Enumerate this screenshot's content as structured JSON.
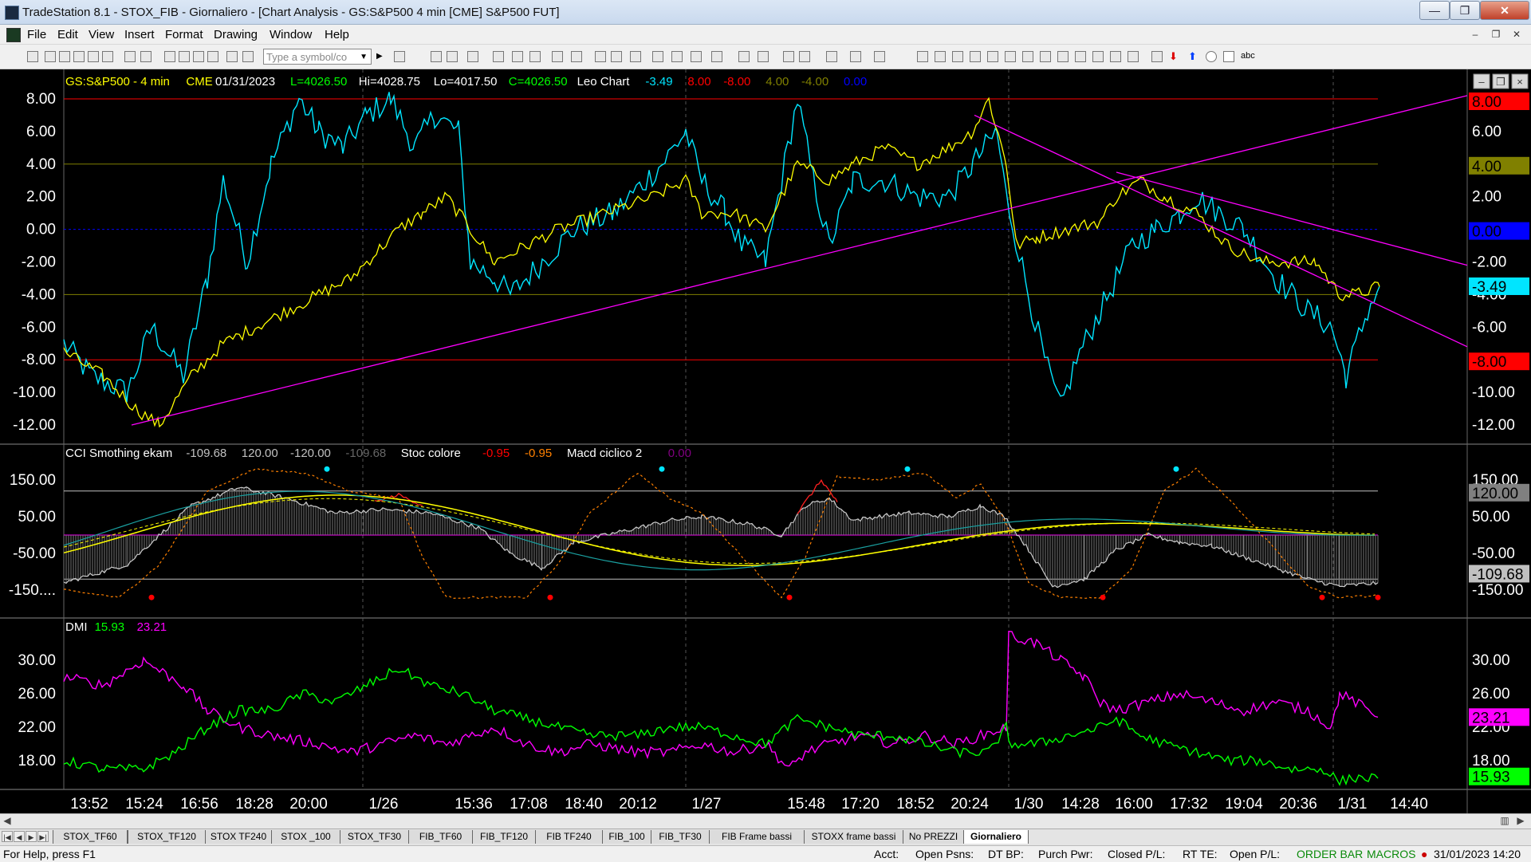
{
  "window": {
    "title": "TradeStation 8.1 - STOX_FIB - Giornaliero - [Chart Analysis - GS:S&P500  4 min  [CME] S&P500 FUT]",
    "buttons": {
      "minimize": "—",
      "maximize": "❐",
      "close": "✕"
    }
  },
  "menu": {
    "items": [
      "File",
      "Edit",
      "View",
      "Insert",
      "Format",
      "Drawing",
      "Window",
      "Help"
    ],
    "mdi": {
      "minimize": "–",
      "restore": "❐",
      "close": "✕"
    }
  },
  "toolbar": {
    "symbol_placeholder": "Type a symbol/co",
    "abc_label": "abc"
  },
  "chart": {
    "price_header": [
      {
        "text": "GS:S&P500 - 4 min",
        "color": "#ffff00"
      },
      {
        "text": "CME",
        "color": "#ffff00"
      },
      {
        "text": "01/31/2023",
        "color": "#ffffff"
      },
      {
        "text": "L=4026.50",
        "color": "#00ff00"
      },
      {
        "text": "Hi=4028.75",
        "color": "#ffffff"
      },
      {
        "text": "Lo=4017.50",
        "color": "#ffffff"
      },
      {
        "text": "C=4026.50",
        "color": "#00ff00"
      },
      {
        "text": "Leo Chart",
        "color": "#ffffff"
      },
      {
        "text": "-3.49",
        "color": "#00e5ff"
      },
      {
        "text": "8.00",
        "color": "#ff0000"
      },
      {
        "text": "-8.00",
        "color": "#ff0000"
      },
      {
        "text": "4.00",
        "color": "#808000"
      },
      {
        "text": "-4.00",
        "color": "#808000"
      },
      {
        "text": "0.00",
        "color": "#0000ff"
      }
    ],
    "cci_header": [
      {
        "text": "CCI Smothing ekam",
        "color": "#ffffff"
      },
      {
        "text": "-109.68",
        "color": "#c0c0c0"
      },
      {
        "text": "120.00",
        "color": "#c0c0c0"
      },
      {
        "text": "-120.00",
        "color": "#c0c0c0"
      },
      {
        "text": "-109.68",
        "color": "#666666"
      },
      {
        "text": "Stoc colore",
        "color": "#ffffff"
      },
      {
        "text": "-0.95",
        "color": "#ff0000"
      },
      {
        "text": "-0.95",
        "color": "#ff8000"
      },
      {
        "text": "Macd ciclico 2",
        "color": "#ffffff"
      },
      {
        "text": "0.00",
        "color": "#800080"
      }
    ],
    "dmi_header": [
      {
        "text": "DMI",
        "color": "#ffffff"
      },
      {
        "text": "15.93",
        "color": "#00ff00"
      },
      {
        "text": "23.21",
        "color": "#ff00ff"
      }
    ],
    "pane1_ticks": [
      "8.00",
      "6.00",
      "4.00",
      "2.00",
      "0.00",
      "-2.00",
      "-4.00",
      "-6.00",
      "-8.00",
      "-10.00",
      "-12.00"
    ],
    "pane1_right_ticks": [
      "6.00",
      "2.00",
      "-2.00",
      "-4.00",
      "-6.00",
      "-10.00",
      "-12.00"
    ],
    "pane2_ticks": [
      "150.00",
      "50.00",
      "-50.00",
      "-150...."
    ],
    "pane2_right_ticks": [
      "150.00",
      "50.00",
      "-50.00",
      "-150.00"
    ],
    "pane3_ticks": [
      "30.00",
      "26.00",
      "22.00",
      "18.00"
    ],
    "right_badges": [
      {
        "text": "8.00",
        "bg": "#ff0000",
        "fg": "#000000"
      },
      {
        "text": "4.00",
        "bg": "#808000",
        "fg": "#000000"
      },
      {
        "text": "0.00",
        "bg": "#0000ff",
        "fg": "#000000"
      },
      {
        "text": "-3.49",
        "bg": "#00e5ff",
        "fg": "#000000"
      },
      {
        "text": "-8.00",
        "bg": "#ff0000",
        "fg": "#000000"
      },
      {
        "text": "120.00",
        "bg": "#808080",
        "fg": "#000000"
      },
      {
        "text": "-109.68",
        "bg": "#c0c0c0",
        "fg": "#000000"
      },
      {
        "text": "23.21",
        "bg": "#ff00ff",
        "fg": "#000000"
      },
      {
        "text": "15.93",
        "bg": "#00ff00",
        "fg": "#000000"
      }
    ],
    "time_labels": [
      "13:52",
      "15:24",
      "16:56",
      "18:28",
      "20:00",
      "1/26",
      "15:36",
      "17:08",
      "18:40",
      "20:12",
      "1/27",
      "15:48",
      "17:20",
      "18:52",
      "20:24",
      "1/30",
      "14:28",
      "16:00",
      "17:32",
      "19:04",
      "20:36",
      "1/31",
      "14:40"
    ],
    "colors": {
      "cyan": "#00e5ff",
      "yellow": "#ffff00",
      "magenta": "#ff00ff",
      "green": "#00ff00",
      "red": "#ff0000",
      "olive": "#808000",
      "blue": "#0000ff"
    }
  },
  "tabs": [
    "STOX_TF60",
    "STOX_TF120",
    "STOX TF240",
    "STOX _100",
    "STOX_TF30",
    "FIB_TF60",
    "FIB_TF120",
    "FIB TF240",
    "FIB_100",
    "FIB_TF30",
    "FIB Frame bassi",
    "STOXX frame bassi",
    "No PREZZI",
    "Giornaliero"
  ],
  "active_tab": "Giornaliero",
  "status": {
    "help": "For Help, press F1",
    "acct": "Acct:",
    "open_psns": "Open Psns:",
    "dt_bp": "DT BP:",
    "purch_pwr": "Purch Pwr:",
    "closed_pl": "Closed P/L:",
    "rt_te": "RT TE:",
    "open_pl": "Open P/L:",
    "order_bar": "ORDER BAR",
    "macros": "MACROS",
    "datetime": "31/01/2023 14:20"
  }
}
